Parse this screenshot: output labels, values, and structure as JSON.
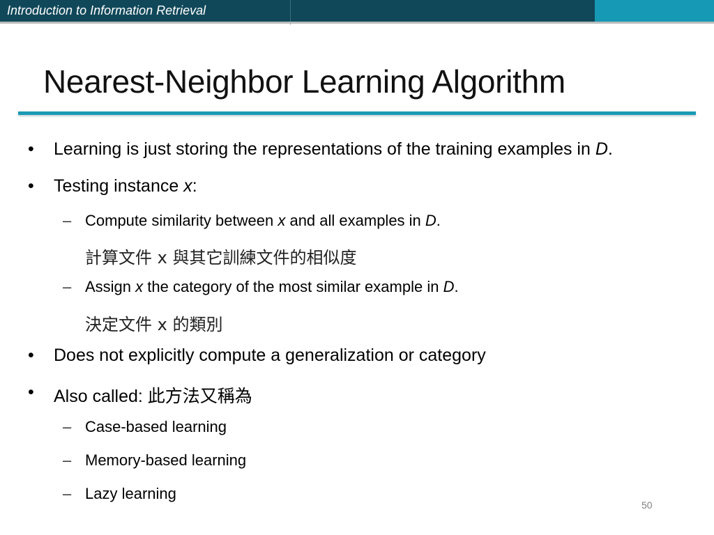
{
  "header": {
    "course_title": "Introduction to Information Retrieval",
    "colors": {
      "dark_bar": "#10485a",
      "accent_bar": "#1599b4",
      "title_rule": "#1a9ab4"
    }
  },
  "slide": {
    "title": "Nearest-Neighbor Learning Algorithm",
    "page_number": "50",
    "bullets": [
      {
        "level": 1,
        "text": "Learning is just storing the representations of the training examples in ",
        "italic_tail": "D",
        "tail": "."
      },
      {
        "level": 1,
        "text": "Testing instance ",
        "italic_tail": "x",
        "tail": ":"
      },
      {
        "level": 2,
        "pre": "Compute similarity between ",
        "it1": "x",
        "mid": " and all examples in ",
        "it2": "D",
        "post": "."
      },
      {
        "level": "note",
        "text": "計算文件 x 與其它訓練文件的相似度"
      },
      {
        "level": 2,
        "pre": "Assign ",
        "it1": "x",
        "mid": " the category of the most similar example in ",
        "it2": "D",
        "post": "."
      },
      {
        "level": "note",
        "text": "決定文件 x 的類別"
      },
      {
        "level": 1,
        "text": "Does not explicitly compute a generalization or category"
      },
      {
        "level": 1,
        "text": "Also called: 此方法又稱為"
      },
      {
        "level": 2,
        "text": "Case-based learning"
      },
      {
        "level": 2,
        "text": "Memory-based learning"
      },
      {
        "level": 2,
        "text": "Lazy learning"
      }
    ],
    "bullet_glyph": "•",
    "dash_glyph": "–"
  }
}
